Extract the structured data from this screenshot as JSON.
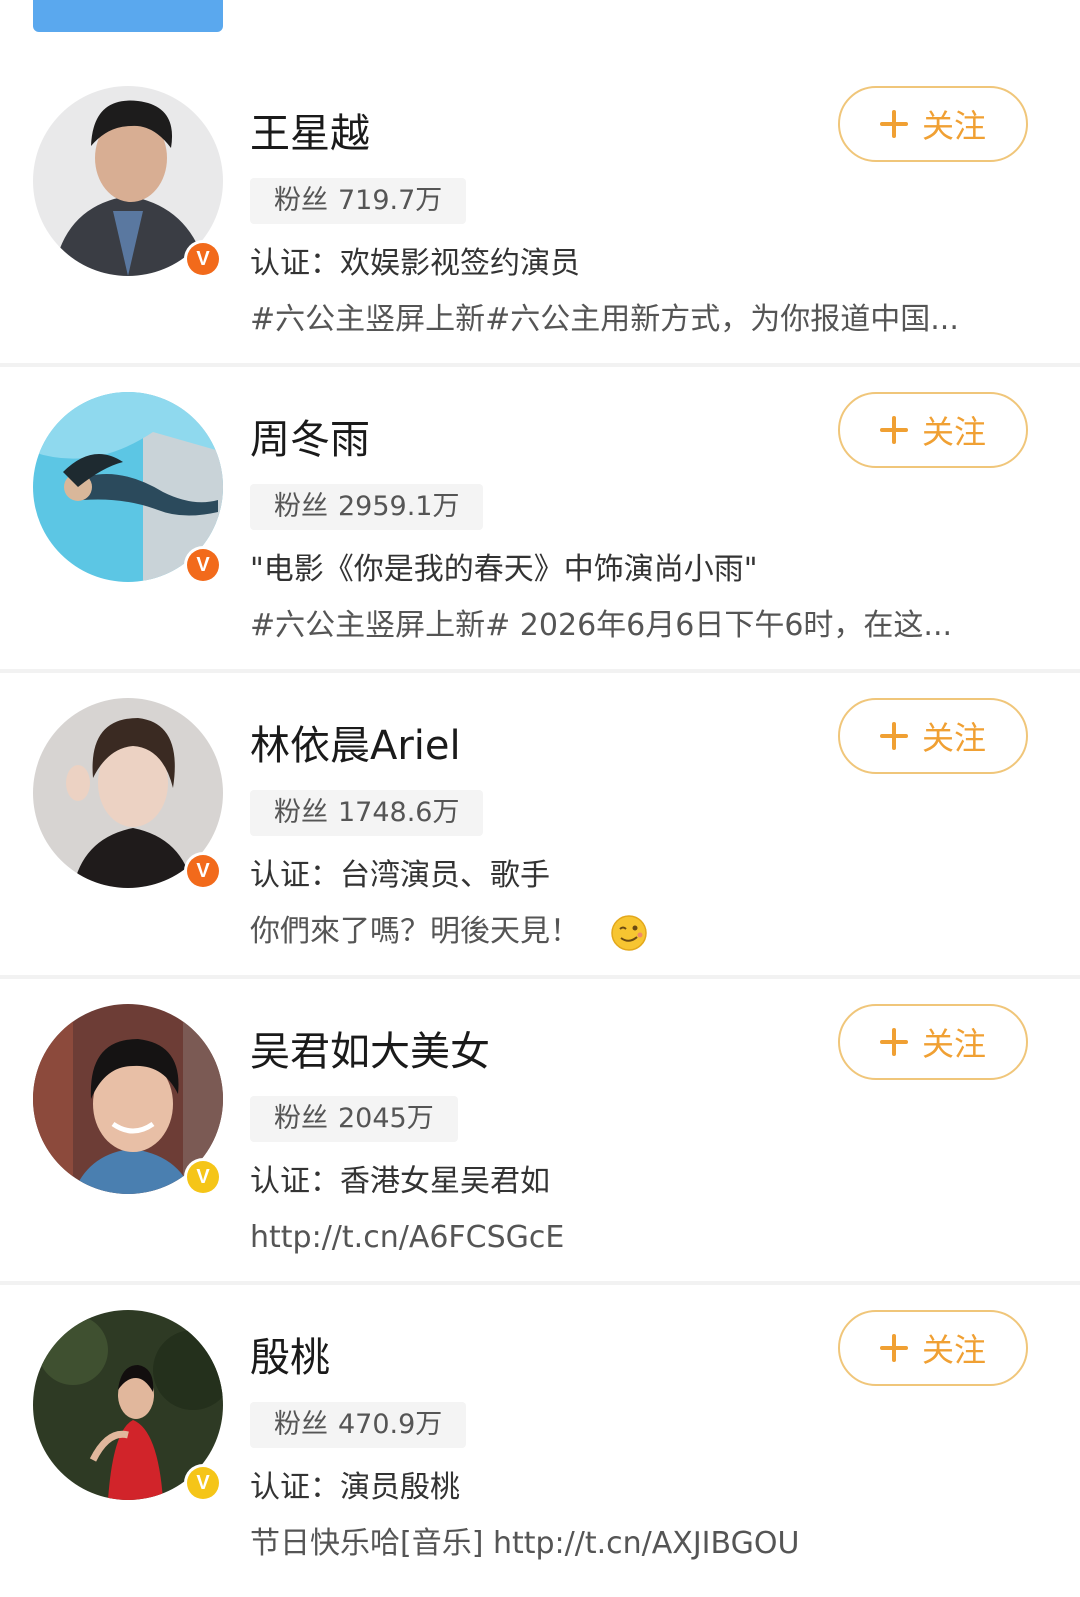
{
  "users": [
    {
      "name": "王星越",
      "fans_label": "粉丝",
      "fans_count": "719.7万",
      "verify_text": "认证：欢娱影视签约演员",
      "bio": "#六公主竖屏上新#六公主用新方式，为你报道中国...",
      "follow_label": "关注",
      "badge_color": "#f26a1b"
    },
    {
      "name": "周冬雨",
      "fans_label": "粉丝",
      "fans_count": "2959.1万",
      "verify_text": "\"电影《你是我的春天》中饰演尚小雨\"",
      "bio": "#六公主竖屏上新# 2026年6月6日下午6时，在这...",
      "follow_label": "关注",
      "badge_color": "#f26a1b"
    },
    {
      "name": "林依晨Ariel",
      "fans_label": "粉丝",
      "fans_count": "1748.6万",
      "verify_text": "认证：台湾演员、歌手",
      "bio": "你們來了嗎？明後天見！",
      "follow_label": "关注",
      "badge_color": "#f26a1b"
    },
    {
      "name": "吴君如大美女",
      "fans_label": "粉丝",
      "fans_count": "2045万",
      "verify_text": "认证：香港女星吴君如",
      "bio": "http://t.cn/A6FCSGcE",
      "follow_label": "关注",
      "badge_color": "#f5c518"
    },
    {
      "name": "殷桃",
      "fans_label": "粉丝",
      "fans_count": "470.9万",
      "verify_text": "认证：演员殷桃",
      "bio": "节日快乐哈[音乐] http://t.cn/AXJIBGOU",
      "follow_label": "关注",
      "badge_color": "#f5c518"
    }
  ],
  "badge_letter": "V",
  "colors": {
    "accent": "#f0a033",
    "follow_border": "#f0c67a",
    "tab_blue": "#5aa8ee"
  }
}
